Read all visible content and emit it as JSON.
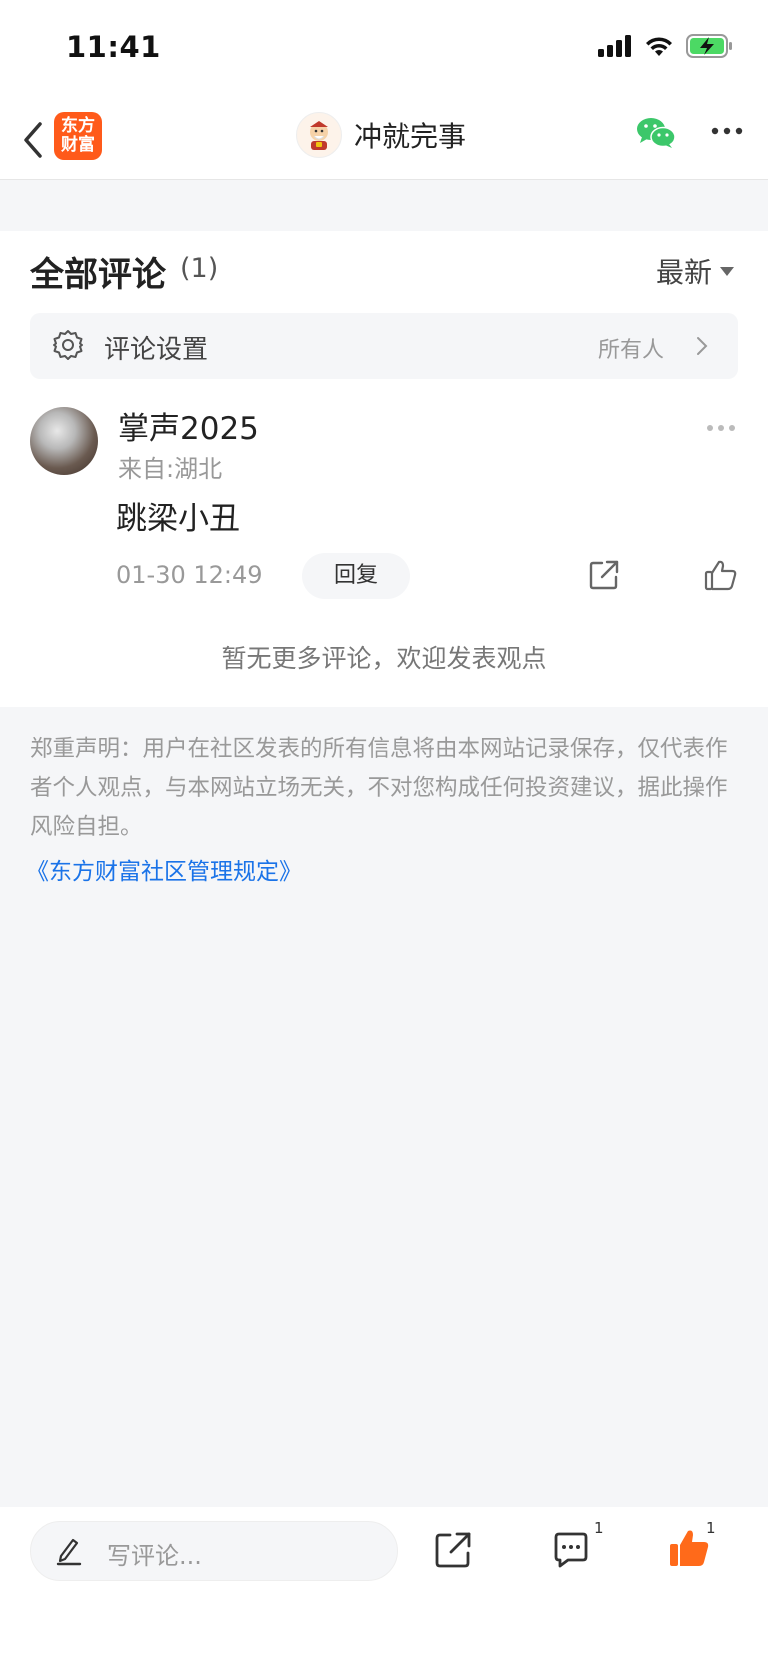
{
  "status_bar": {
    "time": "11:41"
  },
  "nav": {
    "logo_line1": "东方",
    "logo_line2": "财富",
    "title": "冲就完事"
  },
  "comments": {
    "title": "全部评论",
    "count": "(1)",
    "sort_label": "最新",
    "settings_label": "评论设置",
    "settings_value": "所有人",
    "items": [
      {
        "username": "掌声2025",
        "location": "来自:湖北",
        "text": "跳梁小丑",
        "time": "01-30 12:49",
        "reply_label": "回复"
      }
    ],
    "no_more": "暂无更多评论，欢迎发表观点"
  },
  "disclaimer": {
    "text": "郑重声明：用户在社区发表的所有信息将由本网站记录保存，仅代表作者个人观点，与本网站立场无关，不对您构成任何投资建议，据此操作风险自担。",
    "link": "《东方财富社区管理规定》"
  },
  "bottom_bar": {
    "input_placeholder": "写评论...",
    "comment_count": "1",
    "like_count": "1"
  },
  "colors": {
    "brand": "#ff5a1a",
    "link": "#1a73e8",
    "like": "#ff6a1a",
    "wechat": "#3cc76a"
  }
}
